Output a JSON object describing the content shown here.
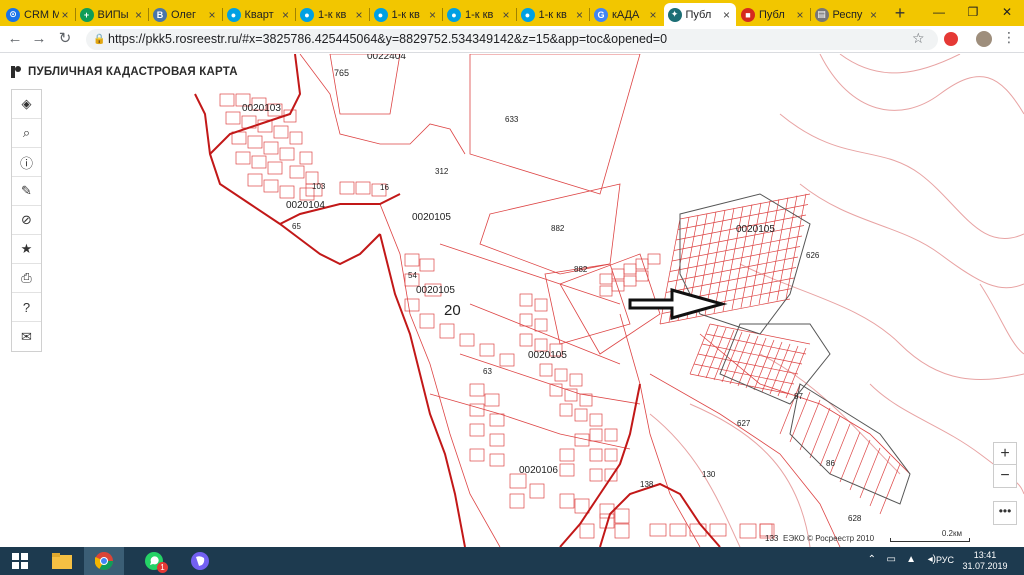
{
  "tabs": [
    {
      "label": "CRM М",
      "color": "#1a73e8",
      "glyph": "⊙"
    },
    {
      "label": "ВИПы",
      "color": "#0f9d58",
      "glyph": "+"
    },
    {
      "label": "Олег",
      "color": "#4a76a8",
      "glyph": "В"
    },
    {
      "label": "Кварт",
      "color": "#00a0e3",
      "glyph": "●"
    },
    {
      "label": "1-к кв",
      "color": "#00a0e3",
      "glyph": "●"
    },
    {
      "label": "1-к кв",
      "color": "#00a0e3",
      "glyph": "●"
    },
    {
      "label": "1-к кв",
      "color": "#00a0e3",
      "glyph": "●"
    },
    {
      "label": "1-к кв",
      "color": "#00a0e3",
      "glyph": "●"
    },
    {
      "label": "кАДА",
      "color": "#4285f4",
      "glyph": "G"
    },
    {
      "label": "Публ",
      "color": "#1c6e75",
      "glyph": "✦"
    },
    {
      "label": "Публ",
      "color": "#d52b1e",
      "glyph": "■"
    },
    {
      "label": "Респу",
      "color": "#777777",
      "glyph": "▤"
    }
  ],
  "active_tab": 9,
  "address": {
    "url": "https://pkk5.rosreestr.ru/#x=3825786.425445064&y=8829752.534349142&z=15&app=toc&opened=0"
  },
  "app": {
    "title": "ПУБЛИЧНАЯ КАДАСТРОВАЯ КАРТА"
  },
  "left_toolbar": [
    {
      "name": "layers-icon",
      "glyph": "◈"
    },
    {
      "name": "search-icon",
      "glyph": "⌕"
    },
    {
      "name": "info-icon",
      "glyph": "ⓘ"
    },
    {
      "name": "pencil-icon",
      "glyph": "✎"
    },
    {
      "name": "measure-icon",
      "glyph": "⊘"
    },
    {
      "name": "star-icon",
      "glyph": "★"
    },
    {
      "name": "print-icon",
      "glyph": "⎙"
    },
    {
      "name": "help-icon",
      "glyph": "?"
    },
    {
      "name": "mail-icon",
      "glyph": "✉"
    }
  ],
  "zoom": {
    "in": "+",
    "out": "−",
    "more": "•••"
  },
  "map_labels": [
    {
      "text": "0022404"
    },
    {
      "text": "765"
    },
    {
      "text": "0020103"
    },
    {
      "text": "0020104"
    },
    {
      "text": "0020105"
    },
    {
      "text": "0020105"
    },
    {
      "text": "0020105"
    },
    {
      "text": "0020105"
    },
    {
      "text": "20"
    },
    {
      "text": "882"
    },
    {
      "text": "882"
    },
    {
      "text": "626"
    },
    {
      "text": "627"
    },
    {
      "text": "0020106"
    },
    {
      "text": "138"
    },
    {
      "text": "130"
    },
    {
      "text": "87"
    },
    {
      "text": "86"
    },
    {
      "text": "628"
    },
    {
      "text": "312"
    },
    {
      "text": "16"
    },
    {
      "text": "103"
    },
    {
      "text": "65"
    },
    {
      "text": "54"
    },
    {
      "text": "63"
    },
    {
      "text": "133"
    },
    {
      "text": "633"
    }
  ],
  "attribution": "ЕЭКО © Росреестр 2010",
  "scale_label": "0.2км",
  "taskbar": {
    "lang": "РУС",
    "time": "13:41",
    "date": "31.07.2019",
    "badge": "1"
  }
}
